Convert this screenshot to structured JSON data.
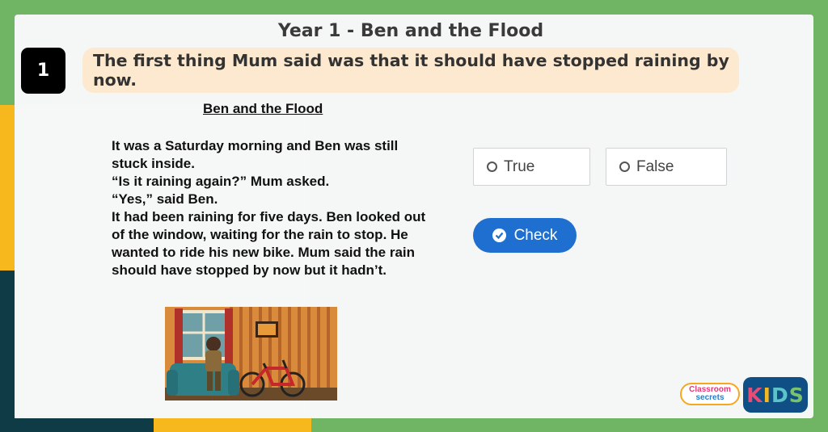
{
  "header": {
    "title": "Year 1 - Ben and the Flood"
  },
  "question": {
    "number": "1",
    "statement": "The first thing Mum said was that it should have stopped raining by now."
  },
  "story": {
    "title": "Ben and the Flood",
    "lines": [
      "It was a Saturday morning and Ben was still stuck inside.",
      "“Is it raining again?” Mum asked.",
      "“Yes,” said Ben.",
      "It had been raining for five days. Ben looked out of the window, waiting for the rain to stop. He wanted to ride his new bike. Mum said the rain should have stopped by now but it hadn’t."
    ]
  },
  "answers": {
    "true_label": "True",
    "false_label": "False",
    "check_label": "Check"
  },
  "logos": {
    "classroom_line1": "Classroom",
    "classroom_line2": "secrets",
    "kids_letters": [
      "K",
      "I",
      "D",
      "S"
    ]
  },
  "colors": {
    "background_green": "#6fb563",
    "accent_yellow": "#f6b81d",
    "accent_navy": "#0f3b47",
    "question_box": "#fde9cf",
    "check_button": "#1f6fd0"
  },
  "icons": {
    "radio_true": "radio-empty-icon",
    "radio_false": "radio-empty-icon",
    "check": "check-circle-icon"
  }
}
